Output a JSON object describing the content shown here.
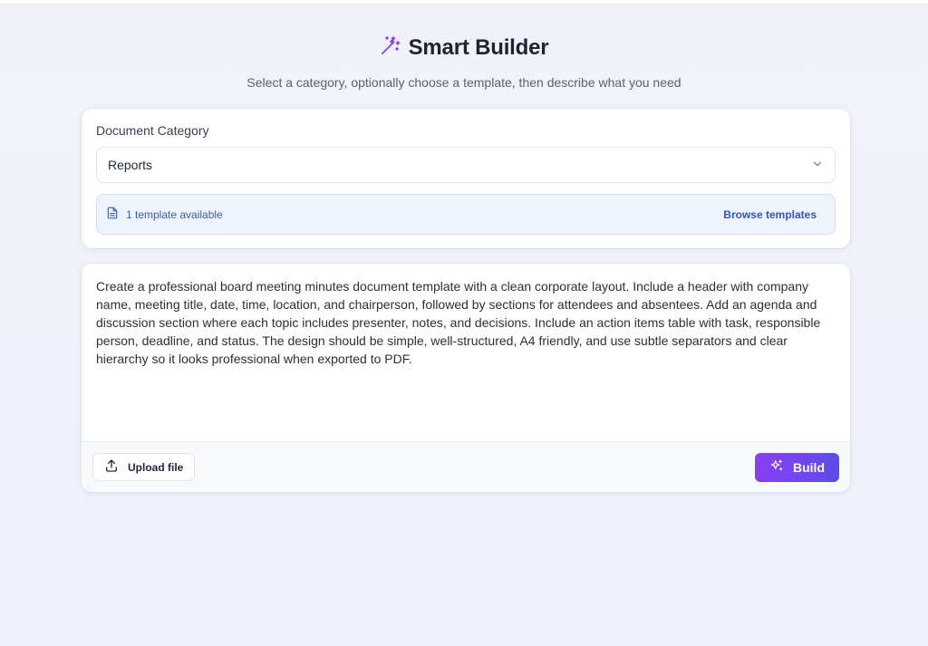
{
  "header": {
    "title": "Smart Builder",
    "subtitle": "Select a category, optionally choose a template, then describe what you need",
    "icon": "magic-wand-icon",
    "accent_color": "#8b3ef4"
  },
  "category": {
    "label": "Document Category",
    "selected": "Reports",
    "template_info": "1 template available",
    "browse_label": "Browse templates"
  },
  "prompt": {
    "value": "Create a professional board meeting minutes document template with a clean corporate layout. Include a header with company name, meeting title, date, time, location, and chairperson, followed by sections for attendees and absentees. Add an agenda and discussion section where each topic includes presenter, notes, and decisions. Include an action items table with task, responsible person, deadline, and status. The design should be simple, well-structured, A4 friendly, and use subtle separators and clear hierarchy so it looks professional when exported to PDF."
  },
  "actions": {
    "upload_label": "Upload file",
    "build_label": "Build",
    "build_color_start": "#8b3ef4",
    "build_color_end": "#5b4ce8"
  }
}
